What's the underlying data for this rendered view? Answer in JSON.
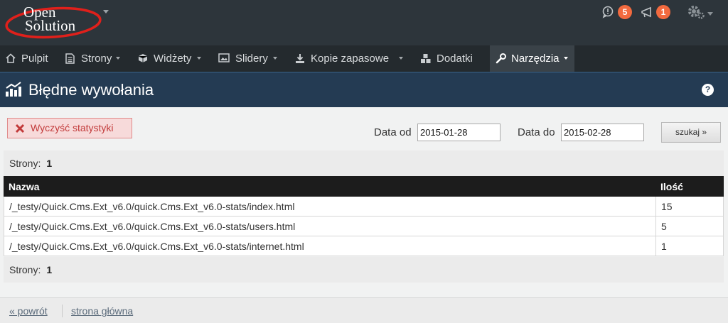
{
  "brand": {
    "line1": "Open",
    "line2": "Solution"
  },
  "topbar": {
    "notifications_count": "5",
    "messages_count": "1"
  },
  "nav": {
    "items": [
      {
        "label": "Pulpit"
      },
      {
        "label": "Strony"
      },
      {
        "label": "Widżety"
      },
      {
        "label": "Slidery"
      },
      {
        "label": "Kopie zapasowe"
      },
      {
        "label": "Dodatki"
      },
      {
        "label": "Narzędzia"
      }
    ]
  },
  "page": {
    "title": "Błędne wywołania",
    "help": "?"
  },
  "filters": {
    "clear_label": "Wyczyść statystyki",
    "date_from_label": "Data od",
    "date_from_value": "2015-01-28",
    "date_to_label": "Data do",
    "date_to_value": "2015-02-28",
    "search_label": "szukaj »"
  },
  "pager": {
    "label": "Strony:",
    "page": "1"
  },
  "table": {
    "headers": {
      "name": "Nazwa",
      "count": "Ilość"
    },
    "rows": [
      {
        "name": "/_testy/Quick.Cms.Ext_v6.0/quick.Cms.Ext_v6.0-stats/index.html",
        "count": "15"
      },
      {
        "name": "/_testy/Quick.Cms.Ext_v6.0/quick.Cms.Ext_v6.0-stats/users.html",
        "count": "5"
      },
      {
        "name": "/_testy/Quick.Cms.Ext_v6.0/quick.Cms.Ext_v6.0-stats/internet.html",
        "count": "1"
      }
    ]
  },
  "footer": {
    "back_label": "« powrót",
    "home_label": "strona główna"
  },
  "colors": {
    "topbar": "#2d353b",
    "nav": "#242a2e",
    "header": "#243b53",
    "badge": "#f26a3f",
    "danger": "#c23a3a"
  }
}
